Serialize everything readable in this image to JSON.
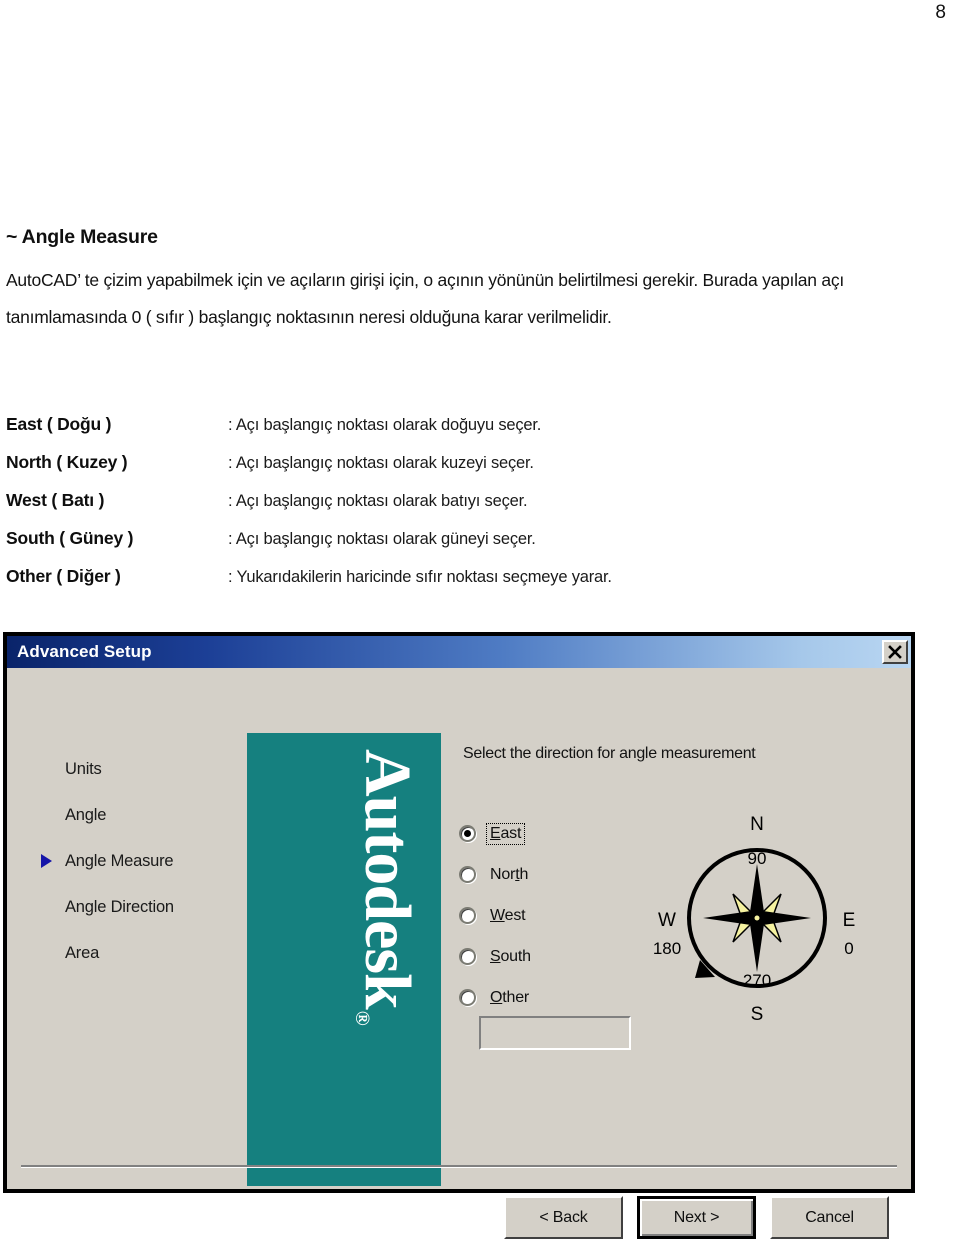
{
  "page": {
    "number": "8"
  },
  "document": {
    "heading": "~ Angle Measure",
    "paragraph": "AutoCAD’ te çizim yapabilmek için ve açıların girişi için, o açının yönünün belirtilmesi gerekir. Burada yapılan açı tanımlamasında 0 ( sıfır ) başlangıç noktasının neresi olduğuna karar verilmelidir.",
    "definitions": [
      {
        "term": "East ( Doğu )",
        "desc": ": Açı başlangıç noktası olarak doğuyu seçer."
      },
      {
        "term": "North ( Kuzey )",
        "desc": ": Açı başlangıç noktası olarak kuzeyi seçer."
      },
      {
        "term": "West ( Batı )",
        "desc": ": Açı başlangıç noktası olarak batıyı seçer."
      },
      {
        "term": "South ( Güney )",
        "desc": ": Açı başlangıç noktası olarak güneyi seçer."
      },
      {
        "term": "Other ( Diğer )",
        "desc": ": Yukarıdakilerin haricinde sıfır noktası seçmeye yarar."
      }
    ]
  },
  "dialog": {
    "title": "Advanced Setup",
    "close_icon": "close-icon",
    "nav": {
      "items": [
        {
          "label": "Units",
          "selected": false
        },
        {
          "label": "Angle",
          "selected": false
        },
        {
          "label": "Angle Measure",
          "selected": true
        },
        {
          "label": "Angle Direction",
          "selected": false
        },
        {
          "label": "Area",
          "selected": false
        }
      ]
    },
    "banner": {
      "brand": "Autodesk",
      "trademark": "®"
    },
    "prompt": "Select the direction for angle measurement",
    "radios": [
      {
        "label": "East",
        "mnemonic": "E",
        "rest": "ast",
        "checked": true
      },
      {
        "label": "North",
        "mnemonic": "t",
        "rest": "",
        "checked": false
      },
      {
        "label": "West",
        "mnemonic": "W",
        "rest": "est",
        "checked": false
      },
      {
        "label": "South",
        "mnemonic": "S",
        "rest": "outh",
        "checked": false
      },
      {
        "label": "Other",
        "mnemonic": "O",
        "rest": "ther",
        "checked": false
      }
    ],
    "other_input": {
      "value": "",
      "placeholder": ""
    },
    "compass": {
      "cardinals": {
        "north": "N",
        "south": "S",
        "east": "E",
        "west": "W"
      },
      "degrees": {
        "top": "90",
        "left": "180",
        "bottom": "270",
        "right": "0"
      },
      "rose_color": "#f5f2a0",
      "direction": "clockwise"
    },
    "buttons": {
      "back": "< Back",
      "next": "Next >",
      "cancel": "Cancel"
    },
    "colors": {
      "titlebar_start": "#0a246a",
      "titlebar_end": "#b9d6f2",
      "face": "#d4d0c8",
      "banner_teal": "#15807f",
      "marker_blue": "#1515a8"
    }
  }
}
